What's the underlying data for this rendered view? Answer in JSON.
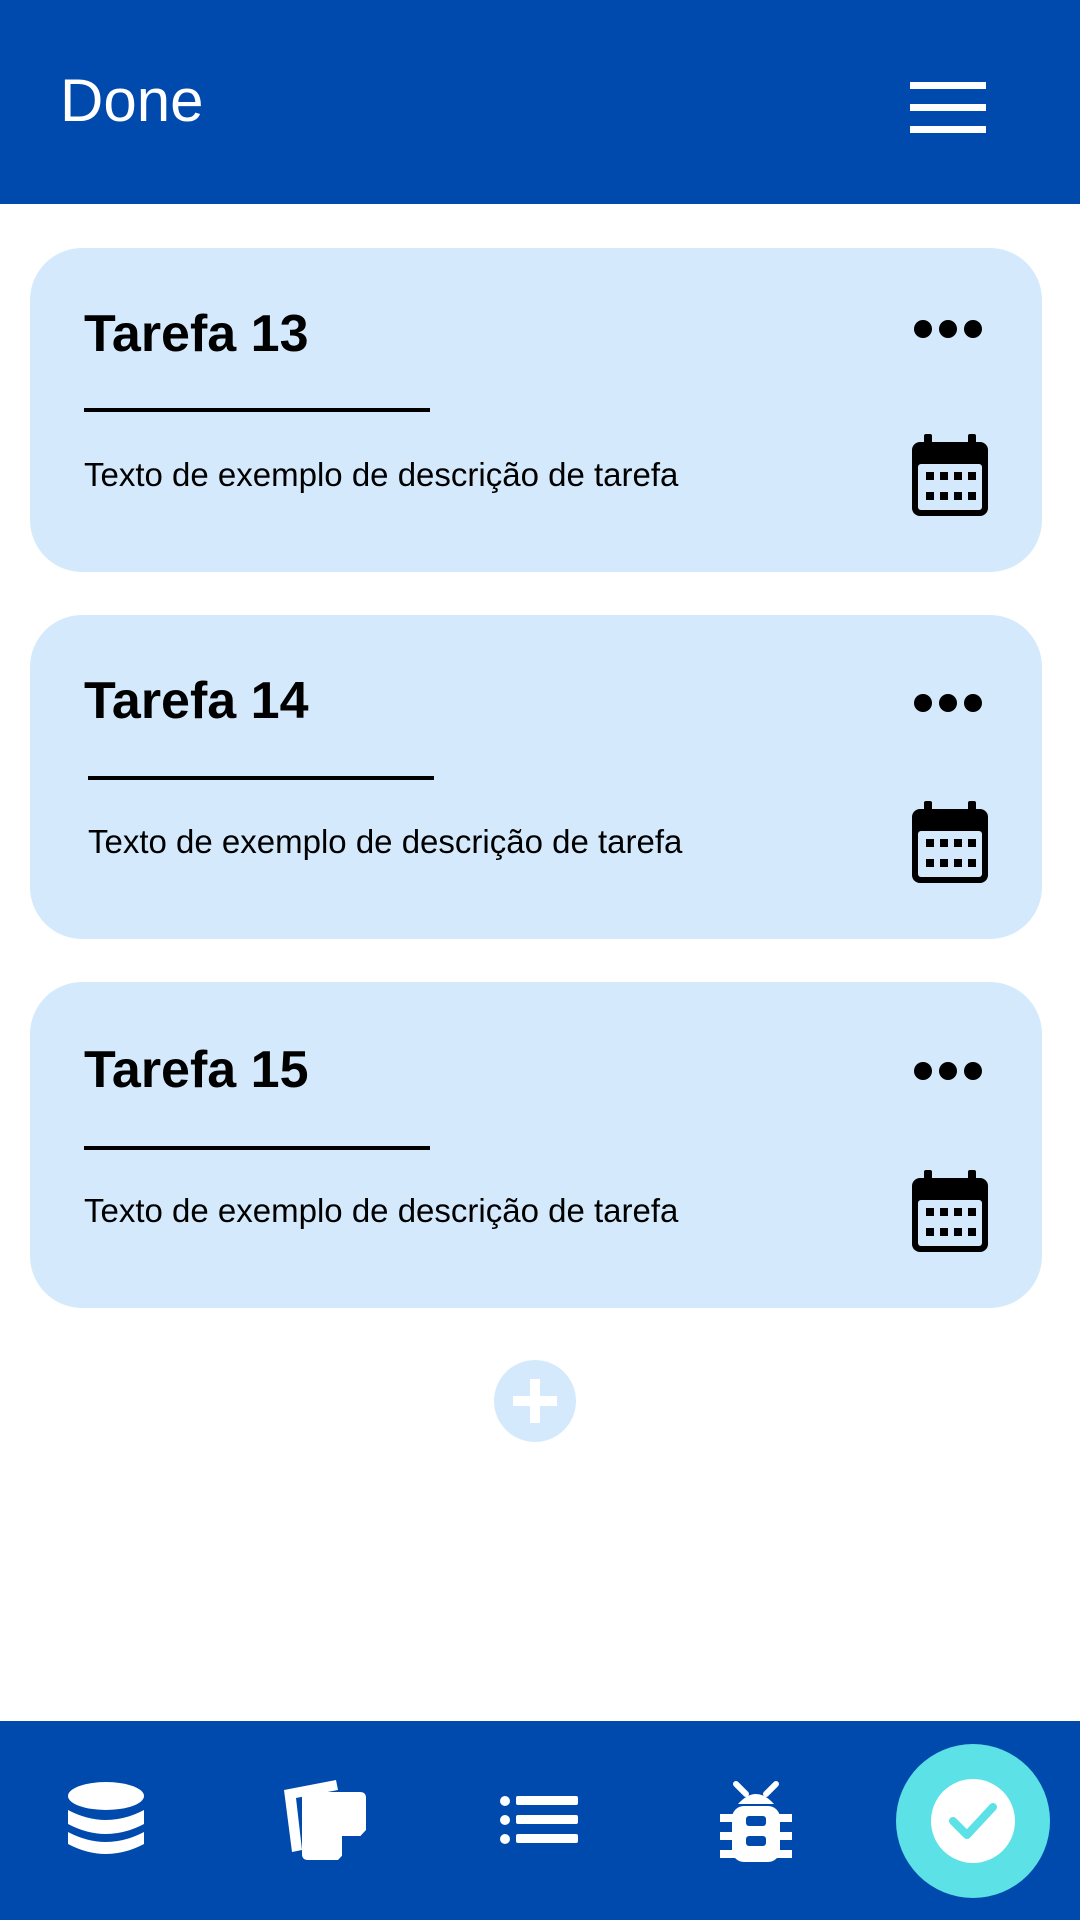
{
  "header": {
    "title": "Done"
  },
  "tasks": [
    {
      "title": "Tarefa 13",
      "description": "Texto de exemplo de descrição de tarefa"
    },
    {
      "title": "Tarefa 14",
      "description": "Texto de exemplo de descrição de tarefa"
    },
    {
      "title": "Tarefa 15",
      "description": "Texto de exemplo de descrição de tarefa"
    }
  ],
  "bottom_nav": {
    "items": [
      "database-icon",
      "notes-icon",
      "list-icon",
      "bug-icon",
      "check-icon"
    ],
    "active": "check-icon"
  },
  "colors": {
    "primary": "#004aad",
    "card": "#d4eafc",
    "accent": "#5ce1e6"
  }
}
